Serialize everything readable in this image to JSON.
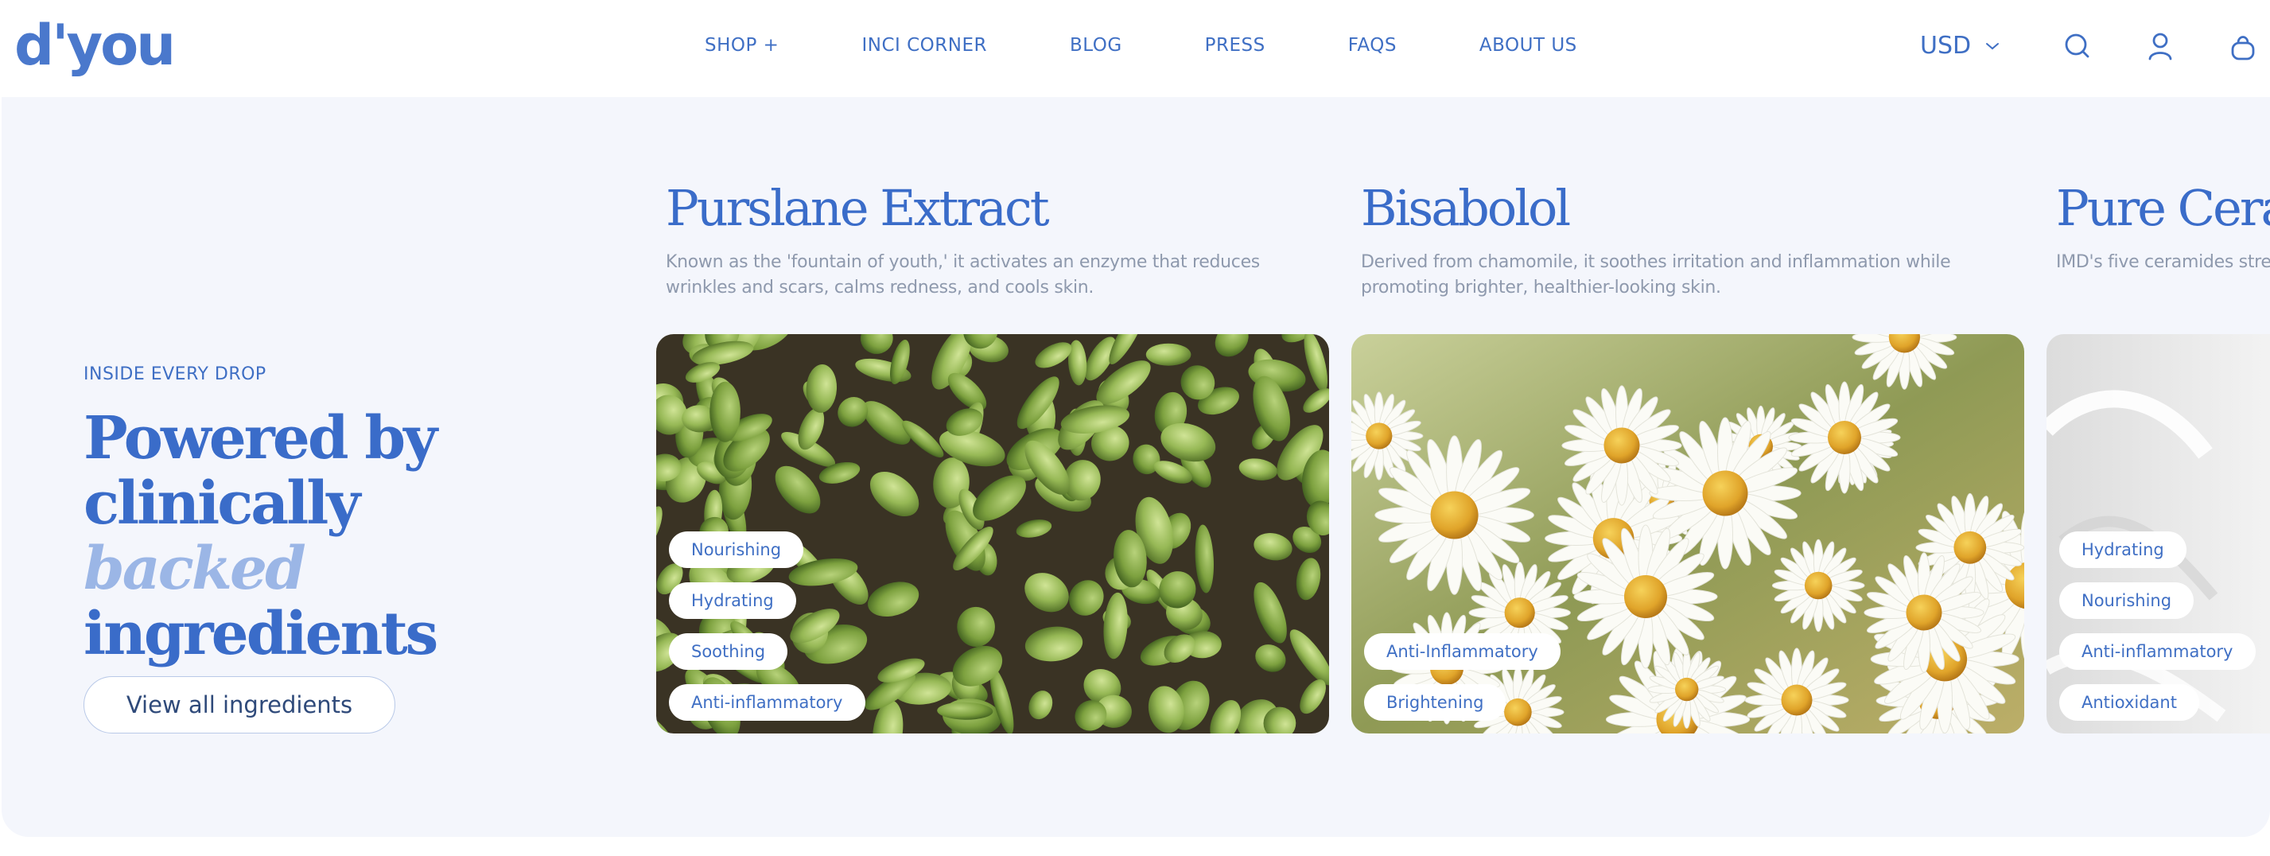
{
  "header": {
    "logo": "d'you",
    "nav": [
      {
        "label": "SHOP +"
      },
      {
        "label": "INCI CORNER"
      },
      {
        "label": "BLOG"
      },
      {
        "label": "PRESS"
      },
      {
        "label": "FAQS"
      },
      {
        "label": "ABOUT US"
      }
    ],
    "currency": "USD",
    "icons": [
      "search-icon",
      "account-icon",
      "cart-icon"
    ]
  },
  "intro": {
    "eyebrow": "INSIDE EVERY DROP",
    "headline_line1": "Powered by",
    "headline_line2": "clinically ",
    "headline_emphasis": "backed",
    "headline_line3": "ingredients",
    "button": "View all ingredients"
  },
  "ingredients": [
    {
      "title": "Purslane Extract",
      "description": "Known as the 'fountain of youth,' it activates an enzyme that reduces wrinkles and scars, calms redness, and cools skin.",
      "tags": [
        "Nourishing",
        "Hydrating",
        "Soothing",
        "Anti-inflammatory"
      ]
    },
    {
      "title": "Bisabolol",
      "description": "Derived from chamomile, it soothes irritation and inflammation while promoting brighter, healthier-looking skin.",
      "tags": [
        "Anti-Inflammatory",
        "Brightening"
      ]
    },
    {
      "title": "Pure Ceram",
      "description": "IMD's five ceramides streng stressors, and visibly impro",
      "tags": [
        "Hydrating",
        "Nourishing",
        "Anti-inflammatory",
        "Antioxidant"
      ]
    }
  ],
  "colors": {
    "brand": "#3f6fc4",
    "section_bg": "#f4f6fc",
    "emphasis": "#9bb6e6",
    "muted_text": "#8e99ad"
  }
}
